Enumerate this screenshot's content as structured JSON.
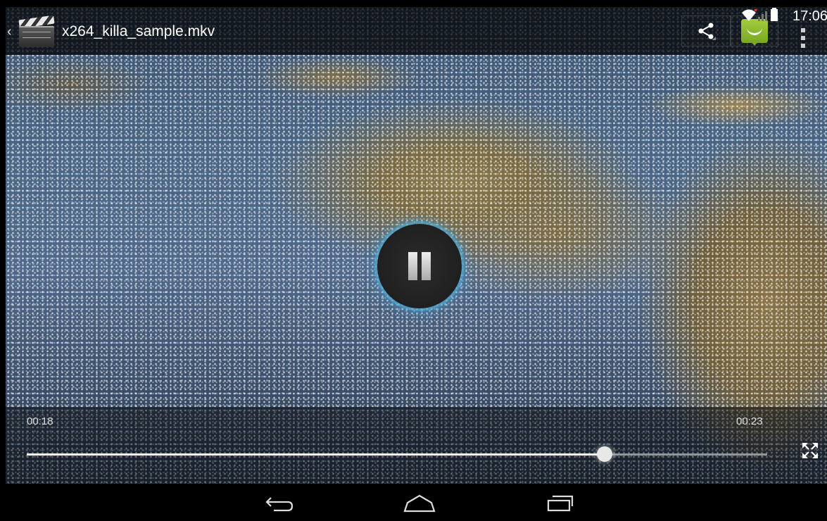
{
  "action_bar": {
    "title": "x264_killa_sample.mkv",
    "app_icon": "clapperboard-icon",
    "share_icon": "share-icon",
    "overflow_icon": "overflow-menu-icon"
  },
  "status_bar": {
    "time": "17:06",
    "icons": [
      "wifi-icon",
      "signal-icon",
      "battery-icon"
    ]
  },
  "player": {
    "state_icon": "pause-icon",
    "current_time": "00:18",
    "total_time": "00:23",
    "progress_fraction": 0.78,
    "fullscreen_icon": "fullscreen-icon"
  },
  "nav_bar": {
    "buttons": [
      "back-icon",
      "home-icon",
      "recents-icon"
    ]
  },
  "colors": {
    "accent_glow": "#4aa6d2",
    "android_green": "#a4cc3d"
  }
}
